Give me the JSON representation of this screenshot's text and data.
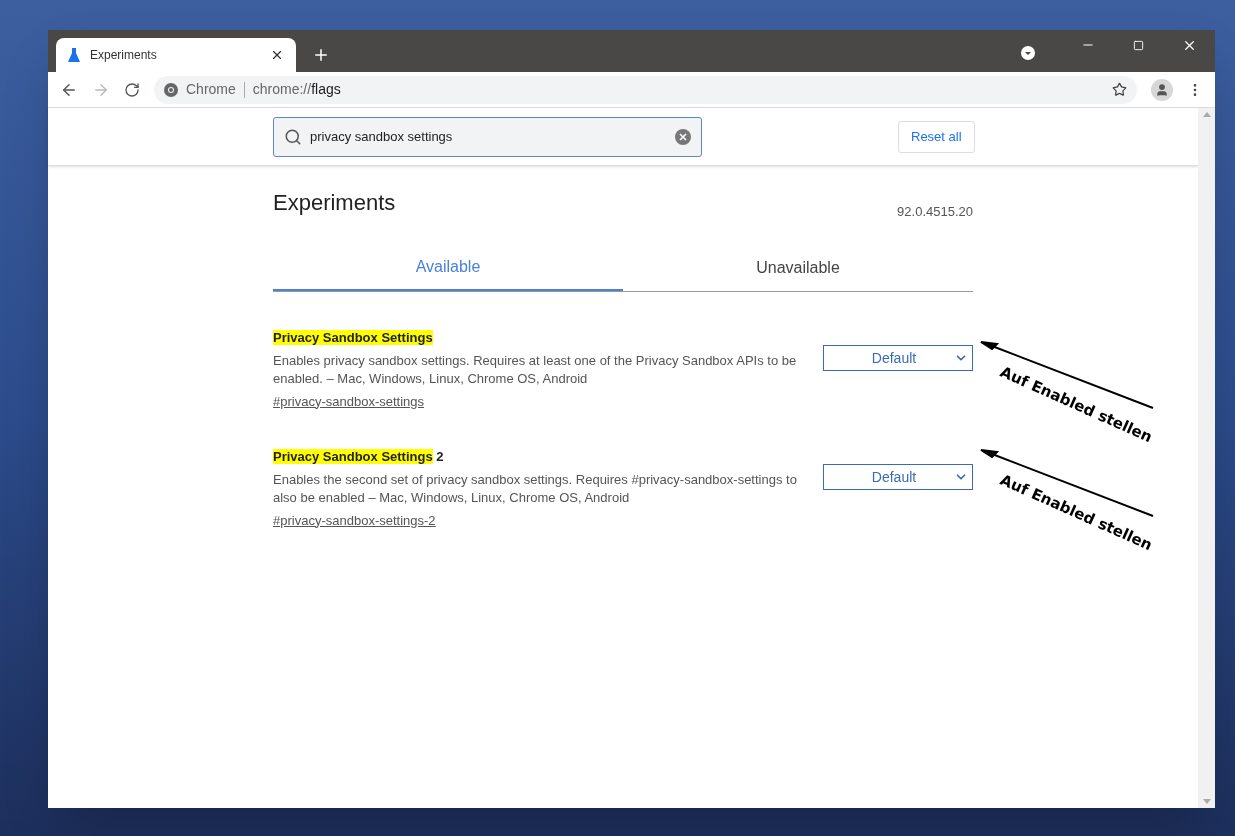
{
  "tab": {
    "title": "Experiments"
  },
  "toolbar": {
    "site_label": "Chrome",
    "url_prefix": "chrome://",
    "url_path": "flags"
  },
  "search": {
    "value": "privacy sandbox settings"
  },
  "reset_button": "Reset all",
  "heading": "Experiments",
  "version": "92.0.4515.20",
  "tabs": [
    {
      "label": "Available",
      "selected": true
    },
    {
      "label": "Unavailable",
      "selected": false
    }
  ],
  "flags": [
    {
      "highlight": "Privacy Sandbox Settings",
      "description": "Enables privacy sandbox settings. Requires at least one of the Privacy Sandbox APIs to be enabled. – Mac, Windows, Linux, Chrome OS, Android",
      "link": "#privacy-sandbox-settings",
      "value": "Default"
    },
    {
      "highlight": "Privacy Sandbox Settings",
      "suffix": "2",
      "description": "Enables the second set of privacy sandbox settings. Requires #privacy-sandbox-settings to also be enabled – Mac, Windows, Linux, Chrome OS, Android",
      "link": "#privacy-sandbox-settings-2",
      "value": "Default"
    }
  ],
  "annotations": [
    "Auf Enabled stellen",
    "Auf Enabled stellen"
  ]
}
